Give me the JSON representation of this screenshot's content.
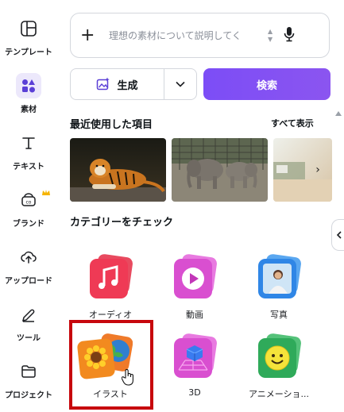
{
  "sidebar": {
    "items": [
      {
        "label": "テンプレート",
        "icon": "template-icon"
      },
      {
        "label": "素材",
        "icon": "elements-icon",
        "active": true
      },
      {
        "label": "テキスト",
        "icon": "text-icon"
      },
      {
        "label": "ブランド",
        "icon": "brand-icon",
        "badge": "crown-icon"
      },
      {
        "label": "アップロード",
        "icon": "upload-icon"
      },
      {
        "label": "ツール",
        "icon": "tools-icon"
      },
      {
        "label": "プロジェクト",
        "icon": "folder-icon"
      }
    ]
  },
  "search": {
    "placeholder": "理想の素材について説明してく",
    "plus": "+"
  },
  "actions": {
    "generate_label": "生成",
    "search_label": "検索"
  },
  "recent": {
    "title": "最近使用した項目",
    "show_all": "すべて表示",
    "next": "›",
    "photos": [
      {
        "name": "tiger-photo"
      },
      {
        "name": "elephants-photo"
      },
      {
        "name": "landscape-photo"
      }
    ]
  },
  "categories": {
    "title": "カテゴリーをチェック",
    "items": [
      {
        "label": "オーディオ",
        "icon": "music-icon"
      },
      {
        "label": "動画",
        "icon": "play-icon"
      },
      {
        "label": "写真",
        "icon": "photo-icon"
      },
      {
        "label": "イラスト",
        "icon": "illustration-icon"
      },
      {
        "label": "3D",
        "icon": "3d-cube-icon"
      },
      {
        "label": "アニメーショ...",
        "icon": "smiley-icon"
      }
    ]
  },
  "colors": {
    "accent": "#7c4df6",
    "highlight": "#c7070d"
  }
}
